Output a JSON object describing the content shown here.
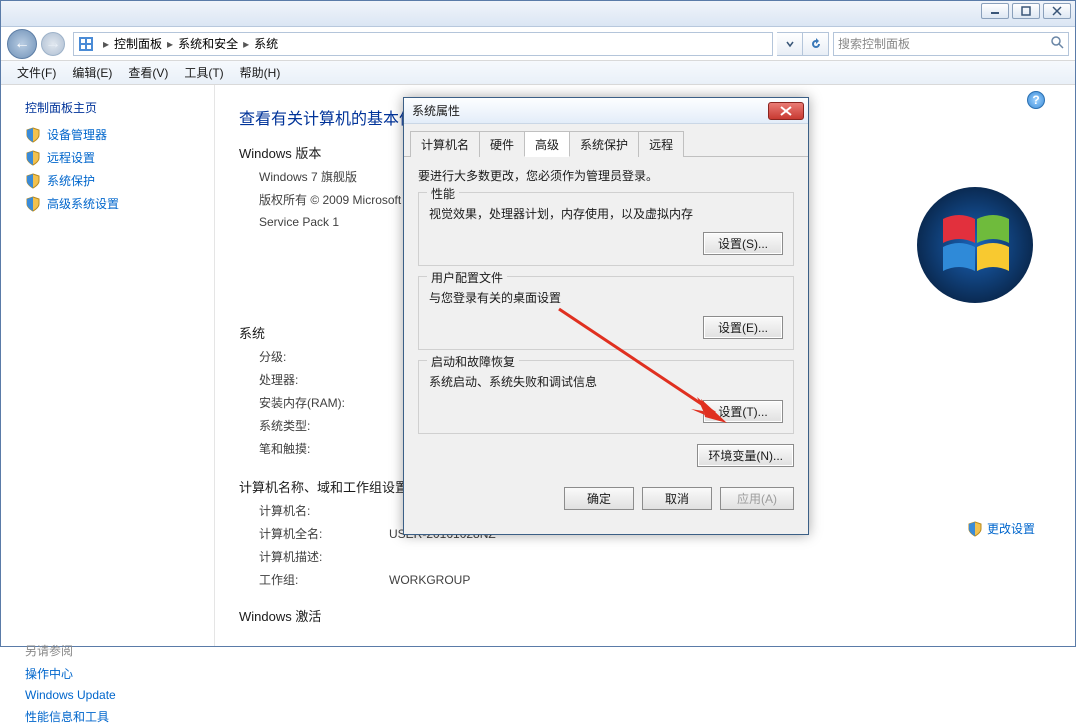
{
  "breadcrumbs": {
    "a": "控制面板",
    "b": "系统和安全",
    "c": "系统"
  },
  "search": {
    "placeholder": "搜索控制面板"
  },
  "menu": {
    "file": "文件(F)",
    "edit": "编辑(E)",
    "view": "查看(V)",
    "tools": "工具(T)",
    "help": "帮助(H)"
  },
  "leftpane": {
    "home": "控制面板主页",
    "devmgr": "设备管理器",
    "remote": "远程设置",
    "sysprotect": "系统保护",
    "advsys": "高级系统设置",
    "seealso": "另请参阅",
    "action": "操作中心",
    "wu": "Windows Update",
    "perf": "性能信息和工具"
  },
  "main": {
    "title": "查看有关计算机的基本信息",
    "winver_head": "Windows 版本",
    "edition": "Windows 7 旗舰版",
    "copyright": "版权所有 © 2009 Microsoft",
    "sp": "Service Pack 1",
    "sys_head": "系统",
    "rating_k": "分级:",
    "cpu_k": "处理器:",
    "ram_k": "安装内存(RAM):",
    "systype_k": "系统类型:",
    "pen_k": "笔和触摸:",
    "name_head": "计算机名称、域和工作组设置",
    "pcname_k": "计算机名:",
    "pcfull_k": "计算机全名:",
    "pcfull_v": "USER-20161028NZ",
    "pcdesc_k": "计算机描述:",
    "wg_k": "工作组:",
    "wg_v": "WORKGROUP",
    "act_head": "Windows 激活",
    "change": "更改设置"
  },
  "dialog": {
    "title": "系统属性",
    "tabs": {
      "a": "计算机名",
      "b": "硬件",
      "c": "高级",
      "d": "系统保护",
      "e": "远程"
    },
    "note": "要进行大多数更改，您必须作为管理员登录。",
    "perf_t": "性能",
    "perf_d": "视觉效果，处理器计划，内存使用，以及虚拟内存",
    "perf_b": "设置(S)...",
    "prof_t": "用户配置文件",
    "prof_d": "与您登录有关的桌面设置",
    "prof_b": "设置(E)...",
    "start_t": "启动和故障恢复",
    "start_d": "系统启动、系统失败和调试信息",
    "start_b": "设置(T)...",
    "env_b": "环境变量(N)...",
    "ok": "确定",
    "cancel": "取消",
    "apply": "应用(A)"
  }
}
